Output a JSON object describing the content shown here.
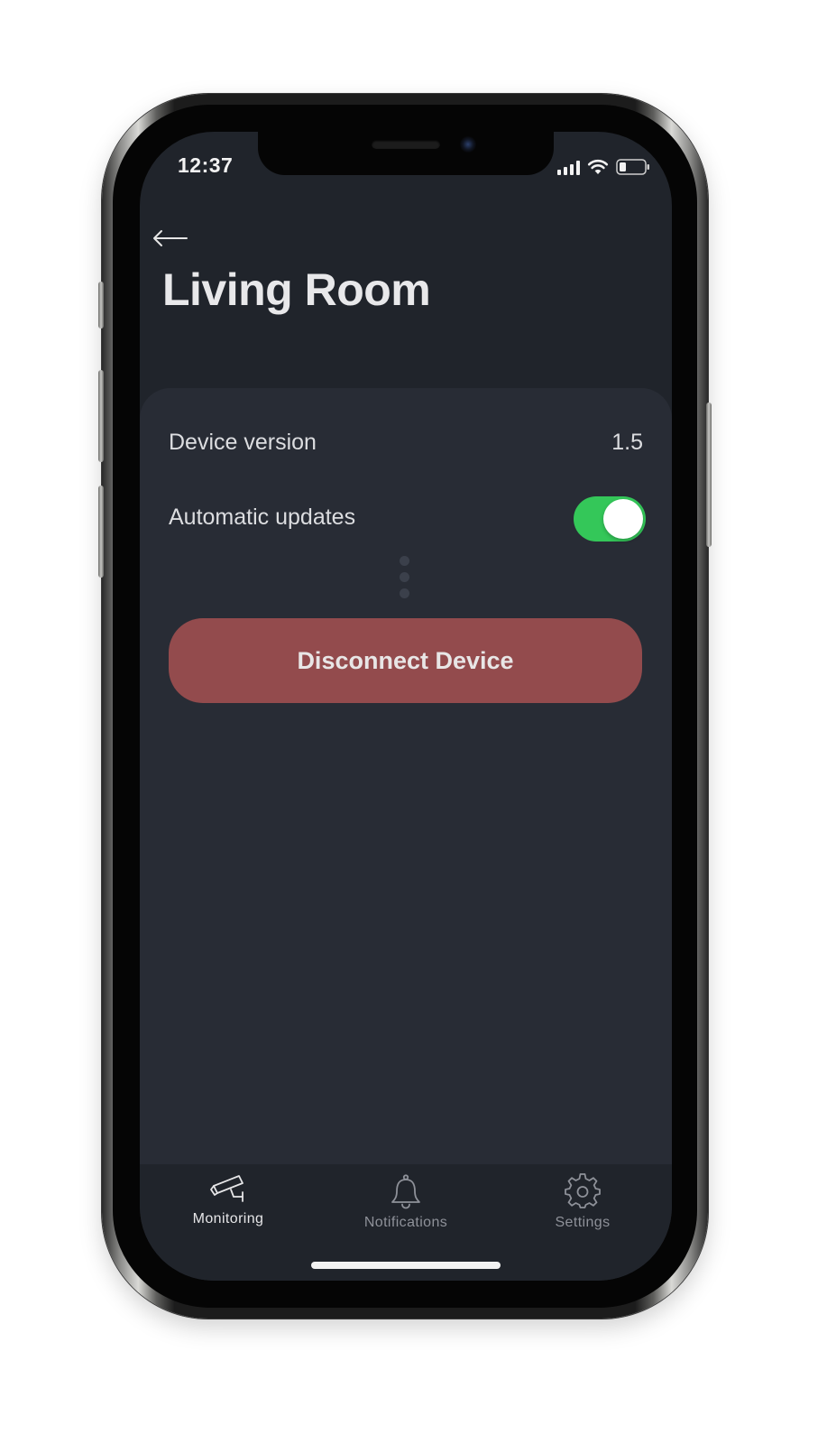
{
  "status_bar": {
    "time": "12:37"
  },
  "header": {
    "back_icon": "left-arrow",
    "title": "Living Room"
  },
  "settings": {
    "device_version_label": "Device version",
    "device_version_value": "1.5",
    "automatic_updates_label": "Automatic updates",
    "automatic_updates_enabled": true,
    "toggle_on_color": "#34c759"
  },
  "actions": {
    "disconnect_label": "Disconnect Device",
    "disconnect_color": "#934b4d"
  },
  "tab_bar": {
    "tabs": [
      {
        "label": "Monitoring",
        "icon": "security-camera-icon",
        "active": true
      },
      {
        "label": "Notifications",
        "icon": "bell-icon",
        "active": false
      },
      {
        "label": "Settings",
        "icon": "gear-icon",
        "active": false
      }
    ],
    "active_color": "#e6e6e8",
    "inactive_color": "#8e9199"
  },
  "theme": {
    "background": "#20242b",
    "card": "#282c35"
  }
}
